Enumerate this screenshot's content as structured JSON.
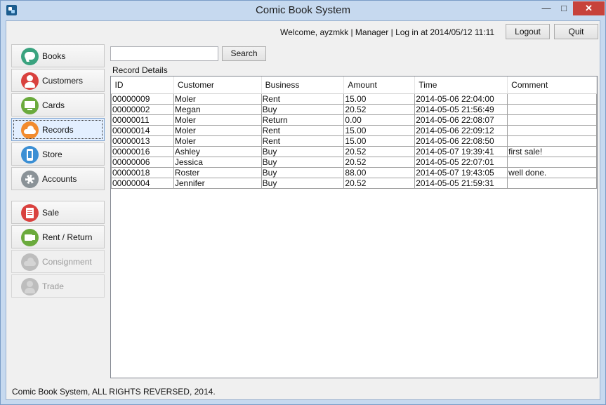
{
  "window": {
    "title": "Comic Book System",
    "controls": {
      "minimize": "—",
      "maximize": "□",
      "close": "✕"
    }
  },
  "header": {
    "welcome": "Welcome, ayzmkk | Manager | Log in at 2014/05/12 11:11",
    "logout_label": "Logout",
    "quit_label": "Quit"
  },
  "search": {
    "value": "",
    "placeholder": "",
    "button_label": "Search"
  },
  "nav": {
    "items": [
      {
        "label": "Books",
        "icon": "chat-bubble-icon",
        "color": "#3aa37f",
        "active": false,
        "enabled": true
      },
      {
        "label": "Customers",
        "icon": "person-icon",
        "color": "#d9413e",
        "active": false,
        "enabled": true
      },
      {
        "label": "Cards",
        "icon": "monitor-icon",
        "color": "#6aaa3c",
        "active": false,
        "enabled": true
      },
      {
        "label": "Records",
        "icon": "cloud-icon",
        "color": "#f28b2e",
        "active": true,
        "enabled": true
      },
      {
        "label": "Store",
        "icon": "phone-icon",
        "color": "#3b8fd4",
        "active": false,
        "enabled": true
      },
      {
        "label": "Accounts",
        "icon": "gear-icon",
        "color": "#8a9297",
        "active": false,
        "enabled": true
      }
    ],
    "actions": [
      {
        "label": "Sale",
        "icon": "receipt-icon",
        "color": "#d9413e",
        "enabled": true
      },
      {
        "label": "Rent / Return",
        "icon": "video-camera-icon",
        "color": "#6aaa3c",
        "enabled": true
      },
      {
        "label": "Consignment",
        "icon": "cloud-icon",
        "color": "#b5b5b5",
        "enabled": false
      },
      {
        "label": "Trade",
        "icon": "person-icon",
        "color": "#b5b5b5",
        "enabled": false
      }
    ]
  },
  "records": {
    "label": "Record Details",
    "columns": [
      "ID",
      "Customer",
      "Business",
      "Amount",
      "Time",
      "Comment"
    ],
    "rows": [
      [
        "00000009",
        "Moler",
        "Rent",
        "15.00",
        "2014-05-06 22:04:00",
        ""
      ],
      [
        "00000002",
        "Megan",
        "Buy",
        "20.52",
        "2014-05-05 21:56:49",
        ""
      ],
      [
        "00000011",
        "Moler",
        "Return",
        "0.00",
        "2014-05-06 22:08:07",
        ""
      ],
      [
        "00000014",
        "Moler",
        "Rent",
        "15.00",
        "2014-05-06 22:09:12",
        ""
      ],
      [
        "00000013",
        "Moler",
        "Rent",
        "15.00",
        "2014-05-06 22:08:50",
        ""
      ],
      [
        "00000016",
        "Ashley",
        "Buy",
        "20.52",
        "2014-05-07 19:39:41",
        "first sale!"
      ],
      [
        "00000006",
        "Jessica",
        "Buy",
        "20.52",
        "2014-05-05 22:07:01",
        ""
      ],
      [
        "00000018",
        "Roster",
        "Buy",
        "88.00",
        "2014-05-07 19:43:05",
        "well done."
      ],
      [
        "00000004",
        "Jennifer",
        "Buy",
        "20.52",
        "2014-05-05 21:59:31",
        ""
      ]
    ]
  },
  "footer": {
    "text": "Comic Book System, ALL RIGHTS REVERSED, 2014."
  }
}
